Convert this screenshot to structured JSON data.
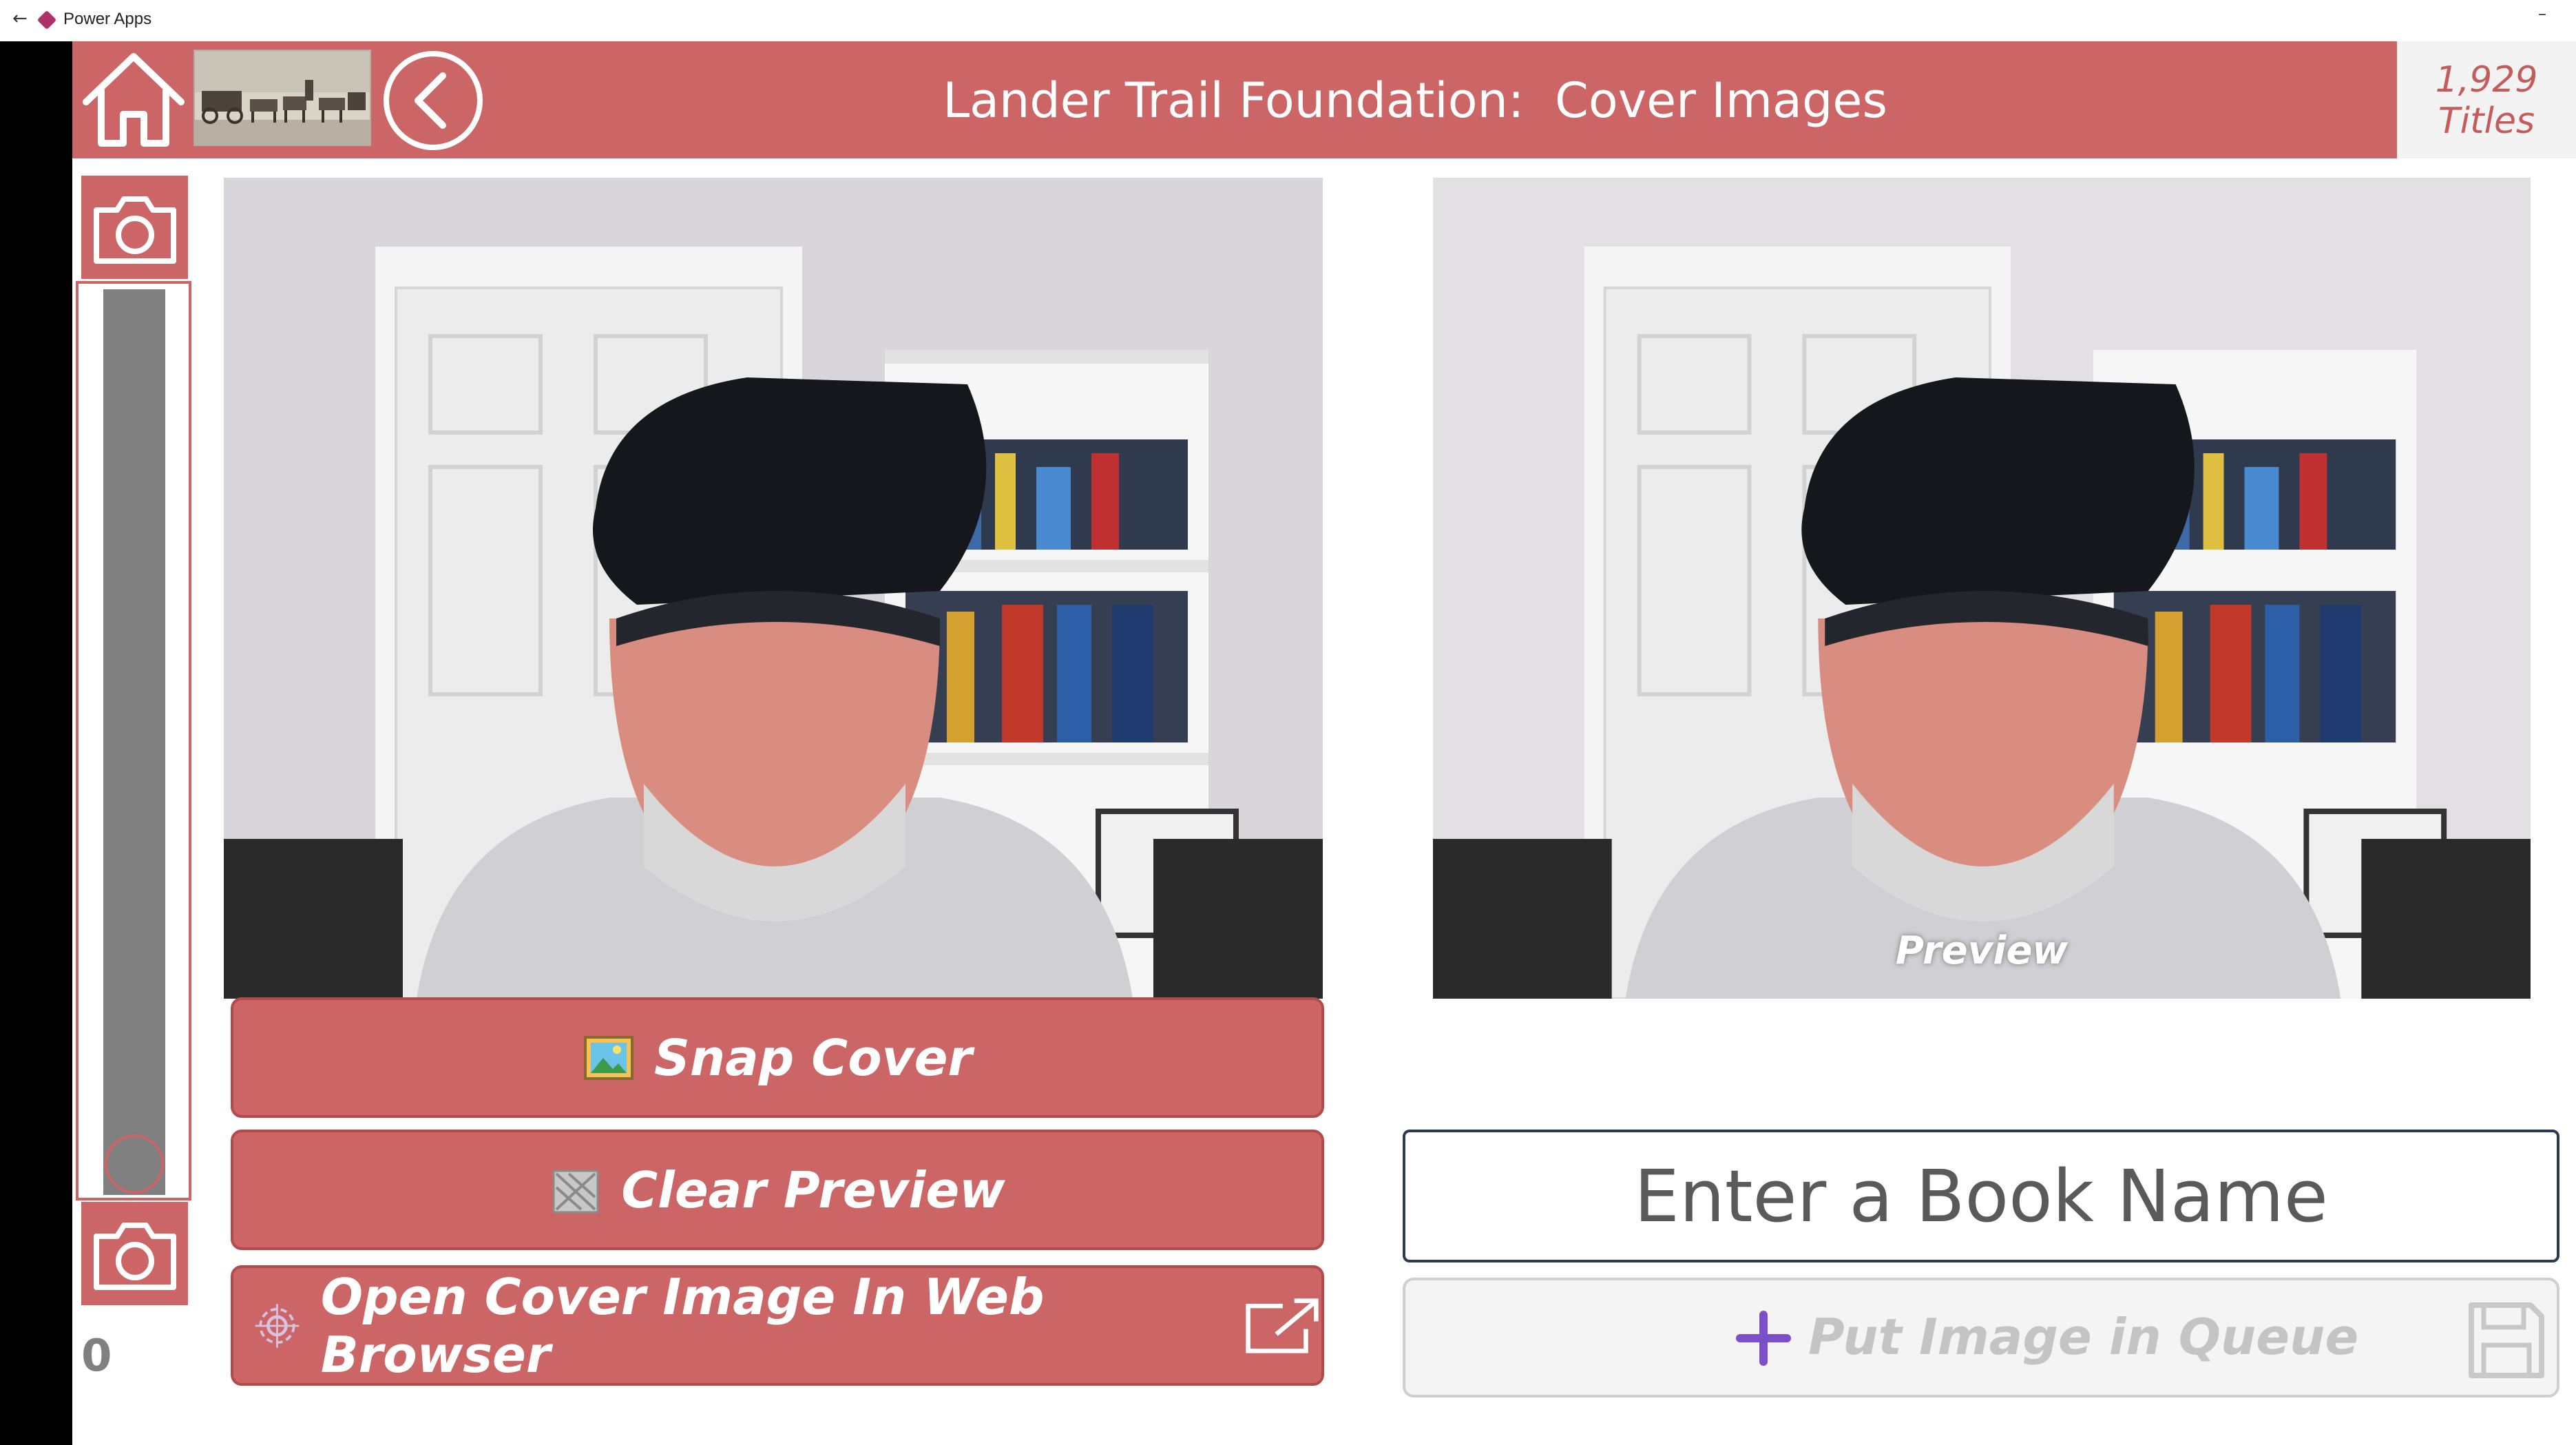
{
  "window": {
    "title": "Power Apps"
  },
  "header": {
    "title": "Lander Trail Foundation:  Cover Images",
    "titles_count": "1,929",
    "titles_label": "Titles"
  },
  "camera": {
    "zoom_value": "0"
  },
  "preview": {
    "label": "Preview"
  },
  "buttons": {
    "snap": "Snap Cover",
    "clear": "Clear Preview",
    "open": "Open Cover Image In Web Browser"
  },
  "book": {
    "placeholder": "Enter a Book Name"
  },
  "queue": {
    "label": "Put Image in Queue"
  },
  "colors": {
    "accent": "#cc6666",
    "accent_dark": "#b24c4c",
    "slider_track": "#808080",
    "input_border": "#2c3a4e",
    "queue_plus": "#7b4fc9",
    "disabled_text": "#c4c4c4"
  },
  "icons": [
    "home-icon",
    "back-arrow-icon",
    "camera-icon",
    "picture-icon",
    "broom-icon",
    "settings-icon",
    "external-link-icon",
    "plus-icon",
    "save-icon"
  ]
}
